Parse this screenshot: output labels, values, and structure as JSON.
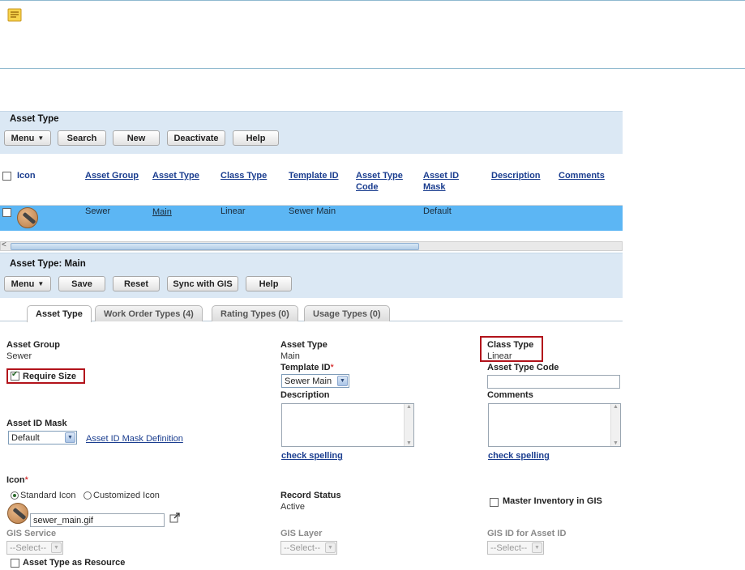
{
  "asset_type_list": {
    "title": "Asset Type",
    "toolbar": {
      "menu": "Menu",
      "search": "Search",
      "new": "New",
      "deactivate": "Deactivate",
      "help": "Help"
    },
    "columns": [
      "Icon",
      "Asset Group",
      "Asset Type",
      "Class Type",
      "Template ID",
      "Asset Type Code",
      "Asset ID Mask",
      "Description",
      "Comments"
    ],
    "column_lines": {
      "asset_type_code": [
        "Asset Type",
        "Code"
      ],
      "asset_id_mask": [
        "Asset ID",
        "Mask"
      ]
    },
    "rows": [
      {
        "asset_group": "Sewer",
        "asset_type": "Main",
        "class_type": "Linear",
        "template_id": "Sewer Main",
        "asset_type_code": "",
        "asset_id_mask": "Default",
        "description": "",
        "comments": ""
      }
    ]
  },
  "detail": {
    "title": "Asset Type: Main",
    "toolbar": {
      "menu": "Menu",
      "save": "Save",
      "reset": "Reset",
      "sync": "Sync with GIS",
      "help": "Help"
    },
    "tabs": [
      "Asset Type",
      "Work Order Types (4)",
      "Rating Types (0)",
      "Usage Types (0)"
    ],
    "active_tab": "Asset Type",
    "fields": {
      "asset_group_label": "Asset Group",
      "asset_group_value": "Sewer",
      "require_size_label": "Require Size",
      "require_size_checked": true,
      "asset_type_label": "Asset Type",
      "asset_type_value": "Main",
      "class_type_label": "Class Type",
      "class_type_value": "Linear",
      "template_id_label": "Template ID",
      "template_id_value": "Sewer Main",
      "asset_type_code_label": "Asset Type Code",
      "asset_type_code_value": "",
      "description_label": "Description",
      "comments_label": "Comments",
      "check_spelling": "check spelling",
      "asset_id_mask_label": "Asset ID Mask",
      "asset_id_mask_value": "Default",
      "asset_id_mask_definition": "Asset ID Mask Definition",
      "icon_label": "Icon",
      "standard_icon": "Standard Icon",
      "customized_icon": "Customized Icon",
      "icon_file": "sewer_main.gif",
      "record_status_label": "Record Status",
      "record_status_value": "Active",
      "master_inventory_label": "Master Inventory in GIS",
      "gis_service_label": "GIS Service",
      "gis_layer_label": "GIS Layer",
      "gis_id_label": "GIS ID for Asset ID",
      "select_placeholder": "--Select--",
      "asset_type_as_resource": "Asset Type as Resource",
      "required_mark": "*"
    }
  },
  "colors": {
    "panel_bg": "#dbe8f4",
    "selected_row": "#5cb6f4",
    "link": "#1a3d8f",
    "highlight_box": "#b2131b"
  }
}
